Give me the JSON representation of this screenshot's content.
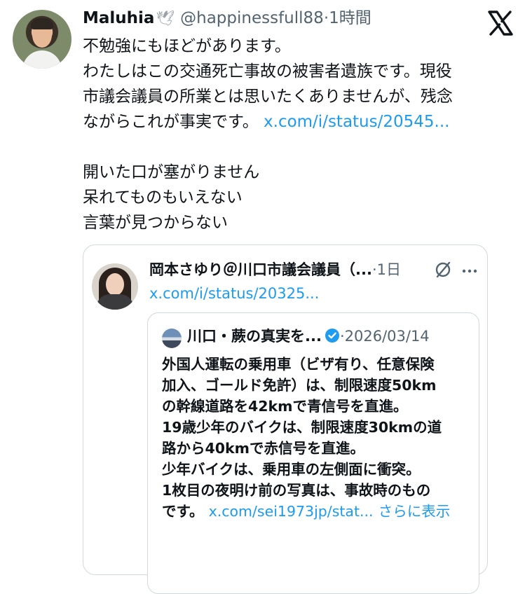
{
  "tweet": {
    "author_name": "Maluhia",
    "author_emoji": "🕊",
    "handle": "@happinessfull88",
    "separator": "·",
    "time": "1時間",
    "lines": [
      "不勉強にもほどがあります。",
      "わたしはこの交通死亡事故の被害者遺族です。現役",
      "市議会議員の所業とは思いたくありませんが、残念"
    ],
    "line4_text": "ながらこれが事実です。",
    "link": "x.com/i/status/20545...",
    "lines2": [
      "開いた口が塞がりません",
      "呆れてものもいえない",
      "言葉が見つからない"
    ]
  },
  "quoted": {
    "author_name": "岡本さゆり＠川口市議会議員（...",
    "separator": "·",
    "time": "1日",
    "link": "x.com/i/status/20325...",
    "nested": {
      "author_name": "川口・蕨の真実を...",
      "separator": "·",
      "date": "2026/03/14",
      "lines": [
        "外国人運転の乗用車（ビザ有り、任意保険",
        "加入、ゴールド免許）は、制限速度50km",
        "の幹線道路を42kmで青信号を直進。",
        "19歳少年のバイクは、制限速度30kmの道",
        "路から40kmで赤信号を直進。",
        "少年バイクは、乗用車の左側面に衝突。",
        "1枚目の夜明け前の写真は、事故時のもの"
      ],
      "last_text": "です。",
      "last_link": "x.com/sei1973jp/stat...",
      "show_more": "さらに表示"
    }
  },
  "icons": {
    "x_logo": "x-logo-icon",
    "pin": "pin-slash-icon",
    "more": "more-icon",
    "verified": "verified-badge-icon",
    "accent": "#1d9bf0"
  }
}
